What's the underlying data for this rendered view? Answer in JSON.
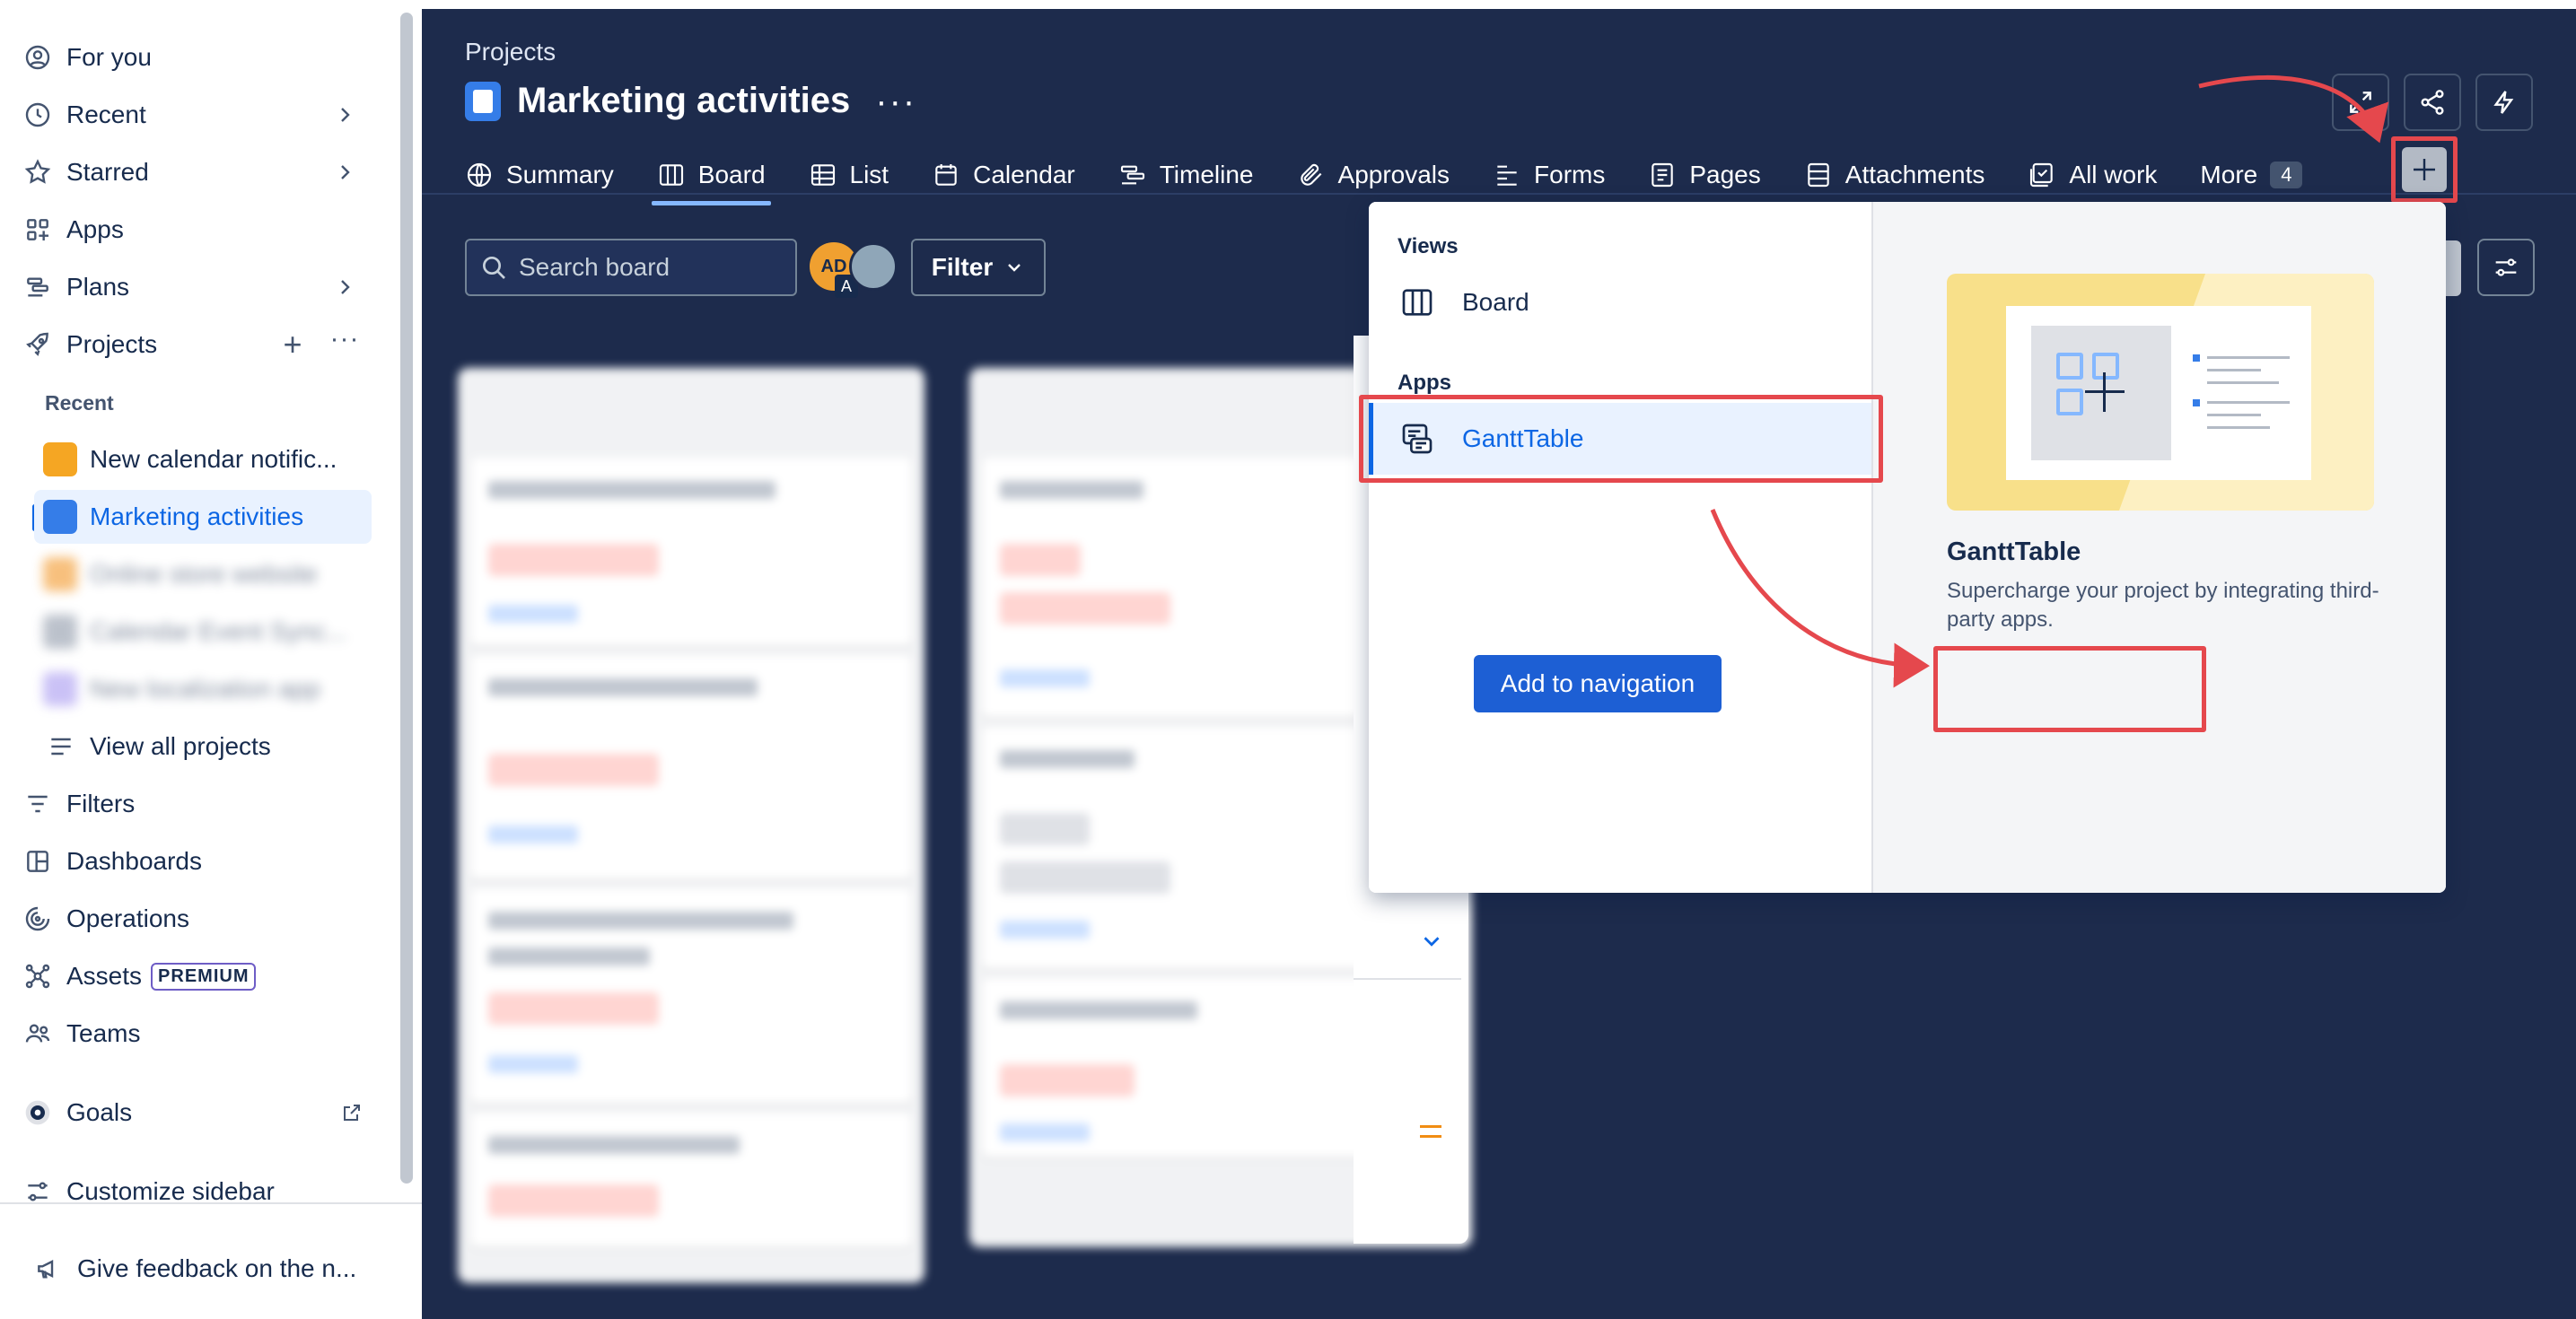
{
  "sidebar": {
    "for_you": "For you",
    "recent": "Recent",
    "starred": "Starred",
    "apps": "Apps",
    "plans": "Plans",
    "projects": "Projects",
    "recent_section": "Recent",
    "recent_projects": [
      {
        "name": "New calendar notific...",
        "color": "#f5a623"
      },
      {
        "name": "Marketing activities",
        "color": "#357de8"
      },
      {
        "name": "Online store website",
        "color": "#f18d13"
      },
      {
        "name": "Calendar Event Sync...",
        "color": "#8590a2"
      },
      {
        "name": "New localization app",
        "color": "#9f8fef"
      }
    ],
    "view_all": "View all projects",
    "filters": "Filters",
    "dashboards": "Dashboards",
    "operations": "Operations",
    "assets": "Assets",
    "premium_badge": "PREMIUM",
    "teams": "Teams",
    "goals": "Goals",
    "customize": "Customize sidebar",
    "feedback": "Give feedback on the n..."
  },
  "header": {
    "breadcrumb": "Projects",
    "title": "Marketing activities",
    "more_dots": "···"
  },
  "tabs": [
    {
      "label": "Summary",
      "icon": "globe-icon"
    },
    {
      "label": "Board",
      "icon": "board-icon",
      "active": true
    },
    {
      "label": "List",
      "icon": "list-icon"
    },
    {
      "label": "Calendar",
      "icon": "calendar-icon"
    },
    {
      "label": "Timeline",
      "icon": "timeline-icon"
    },
    {
      "label": "Approvals",
      "icon": "paperclip-icon"
    },
    {
      "label": "Forms",
      "icon": "forms-icon"
    },
    {
      "label": "Pages",
      "icon": "pages-icon"
    },
    {
      "label": "Attachments",
      "icon": "attachments-icon"
    },
    {
      "label": "All work",
      "icon": "all-work-icon"
    },
    {
      "label": "More",
      "count": "4"
    }
  ],
  "toolbar": {
    "search_placeholder": "Search board",
    "filter_label": "Filter",
    "avatar_initials": "AD",
    "avatar_sub": "A"
  },
  "popup": {
    "views_heading": "Views",
    "board_item": "Board",
    "apps_heading": "Apps",
    "app_item": "GanttTable",
    "app_name": "GanttTable",
    "app_desc": "Supercharge your project by integrating third-party apps.",
    "add_button": "Add to navigation"
  },
  "colors": {
    "main_bg": "#1d2b4c",
    "accent": "#0c66e4",
    "highlight": "#e5484d"
  }
}
